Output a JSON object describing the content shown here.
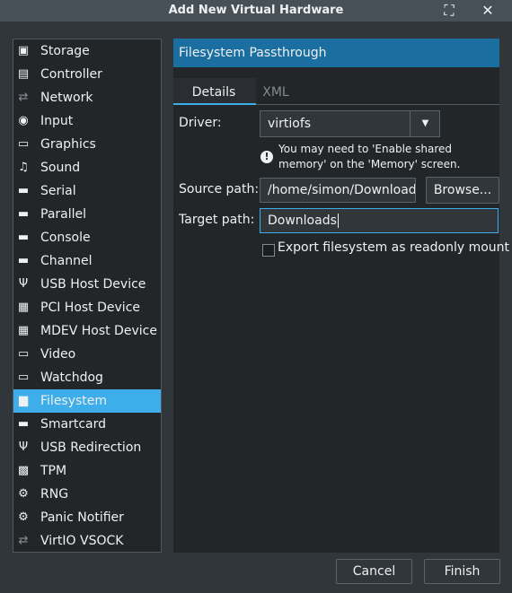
{
  "window": {
    "title": "Add New Virtual Hardware",
    "maximize_icon": "maximize-icon",
    "close_icon": "close-icon"
  },
  "sidebar": {
    "selected": "Filesystem",
    "items": [
      {
        "label": "Storage",
        "icon": "storage-icon",
        "glyph": "▣"
      },
      {
        "label": "Controller",
        "icon": "controller-icon",
        "glyph": "▤"
      },
      {
        "label": "Network",
        "icon": "network-icon",
        "glyph": "⇄"
      },
      {
        "label": "Input",
        "icon": "mouse-icon",
        "glyph": "◉"
      },
      {
        "label": "Graphics",
        "icon": "monitor-icon",
        "glyph": "▭"
      },
      {
        "label": "Sound",
        "icon": "sound-icon",
        "glyph": "♫"
      },
      {
        "label": "Serial",
        "icon": "serial-icon",
        "glyph": "▬"
      },
      {
        "label": "Parallel",
        "icon": "parallel-icon",
        "glyph": "▬"
      },
      {
        "label": "Console",
        "icon": "console-icon",
        "glyph": "▬"
      },
      {
        "label": "Channel",
        "icon": "channel-icon",
        "glyph": "▬"
      },
      {
        "label": "USB Host Device",
        "icon": "usb-icon",
        "glyph": "Ψ"
      },
      {
        "label": "PCI Host Device",
        "icon": "pci-card-icon",
        "glyph": "▦"
      },
      {
        "label": "MDEV Host Device",
        "icon": "mdev-card-icon",
        "glyph": "▦"
      },
      {
        "label": "Video",
        "icon": "video-monitor-icon",
        "glyph": "▭"
      },
      {
        "label": "Watchdog",
        "icon": "watchdog-icon",
        "glyph": "▭"
      },
      {
        "label": "Filesystem",
        "icon": "folder-icon",
        "glyph": "▆"
      },
      {
        "label": "Smartcard",
        "icon": "smartcard-icon",
        "glyph": "▬"
      },
      {
        "label": "USB Redirection",
        "icon": "usb-redirection-icon",
        "glyph": "Ψ"
      },
      {
        "label": "TPM",
        "icon": "tpm-chip-icon",
        "glyph": "▩"
      },
      {
        "label": "RNG",
        "icon": "rng-gear-icon",
        "glyph": "⚙"
      },
      {
        "label": "Panic Notifier",
        "icon": "panic-gear-icon",
        "glyph": "⚙"
      },
      {
        "label": "VirtIO VSOCK",
        "icon": "vsock-icon",
        "glyph": "⇄"
      }
    ]
  },
  "panel": {
    "header": "Filesystem Passthrough",
    "tabs": [
      "Details",
      "XML"
    ],
    "active_tab": "Details",
    "driver_label": "Driver:",
    "driver_value": "virtiofs",
    "warning_icon": "warning-icon",
    "warning_text": "You may need to 'Enable shared memory' on the 'Memory' screen.",
    "source_label": "Source path:",
    "source_value": "/home/simon/Downloads",
    "browse_label": "Browse...",
    "target_label": "Target path:",
    "target_value": "Downloads",
    "readonly_label": "Export filesystem as readonly mount",
    "readonly_checked": false
  },
  "footer": {
    "cancel_label": "Cancel",
    "finish_label": "Finish"
  }
}
